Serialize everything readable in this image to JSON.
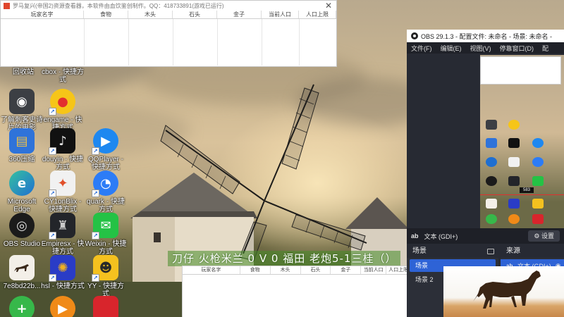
{
  "app_window": {
    "title": "罗马复兴(帝国2)资源查看器，本软件由血饮鉴创制作。QQ：418733891(游戏已运行)",
    "close_label": "✕",
    "columns": [
      "玩家名字",
      "食物",
      "木头",
      "石头",
      "金子",
      "当前人口",
      "人口上限"
    ]
  },
  "desktop_icons": [
    {
      "label": "回收站",
      "glyph": ""
    },
    {
      "label": "cbox - 快捷方式",
      "glyph": ""
    },
    {
      "label": "了解刺客史诗片的电影",
      "glyph": "◉"
    },
    {
      "label": "engame - 快捷方式",
      "glyph": "●"
    },
    {
      "label": "360压缩",
      "glyph": "▤"
    },
    {
      "label": "douyin - 快捷方式",
      "glyph": "♪"
    },
    {
      "label": "QQPlayer - 快捷方式",
      "glyph": "▶"
    },
    {
      "label": "Microsoft Edge",
      "glyph": "e"
    },
    {
      "label": "CY1onBlix - 快捷方式",
      "glyph": "✦"
    },
    {
      "label": "quark - 快捷方式",
      "glyph": "◔"
    },
    {
      "label": "OBS Studio",
      "glyph": "◎"
    },
    {
      "label": "Empiresx - 快捷方式",
      "glyph": "♜"
    },
    {
      "label": "Weixin - 快捷方式",
      "glyph": "✉"
    },
    {
      "label": "7e8bd22b...",
      "glyph": ""
    },
    {
      "label": "hsl - 快捷方式",
      "glyph": "✺"
    },
    {
      "label": "YY - 快捷方式",
      "glyph": "☻"
    },
    {
      "label": "",
      "glyph": "+"
    },
    {
      "label": "",
      "glyph": "▶"
    },
    {
      "label": "",
      "glyph": ""
    }
  ],
  "overlay_text": "刀仔 火枪米兰 0 V 0 福田 老炮5-1三桂（）",
  "obs": {
    "title": "OBS 29.1.3 - 配置文件: 未命名 - 场景: 未命名 -",
    "menu": [
      "文件(F)",
      "编辑(E)",
      "视图(V)",
      "停靠窗口(D)",
      "配"
    ],
    "source_bar_label": "文本 (GDI+)",
    "source_bar_prefix": "ab",
    "settings_label": "⚙ 设置",
    "preview_badge": "583",
    "scenes_header": "场景",
    "scenes": [
      {
        "label": "场景",
        "active": true
      },
      {
        "label": "场景 2",
        "active": false
      }
    ],
    "sources_header": "来源",
    "sources": [
      {
        "icon": "ab",
        "label": "文本 (GDI+)",
        "active": true
      },
      {
        "icon": "▣",
        "label": "图像",
        "active": false
      },
      {
        "icon": "▭",
        "label": "",
        "active": false
      }
    ]
  },
  "colors": {
    "obs_bg": "#272a33",
    "obs_accent": "#2e63d6",
    "overlay_bg": "#468c28"
  }
}
